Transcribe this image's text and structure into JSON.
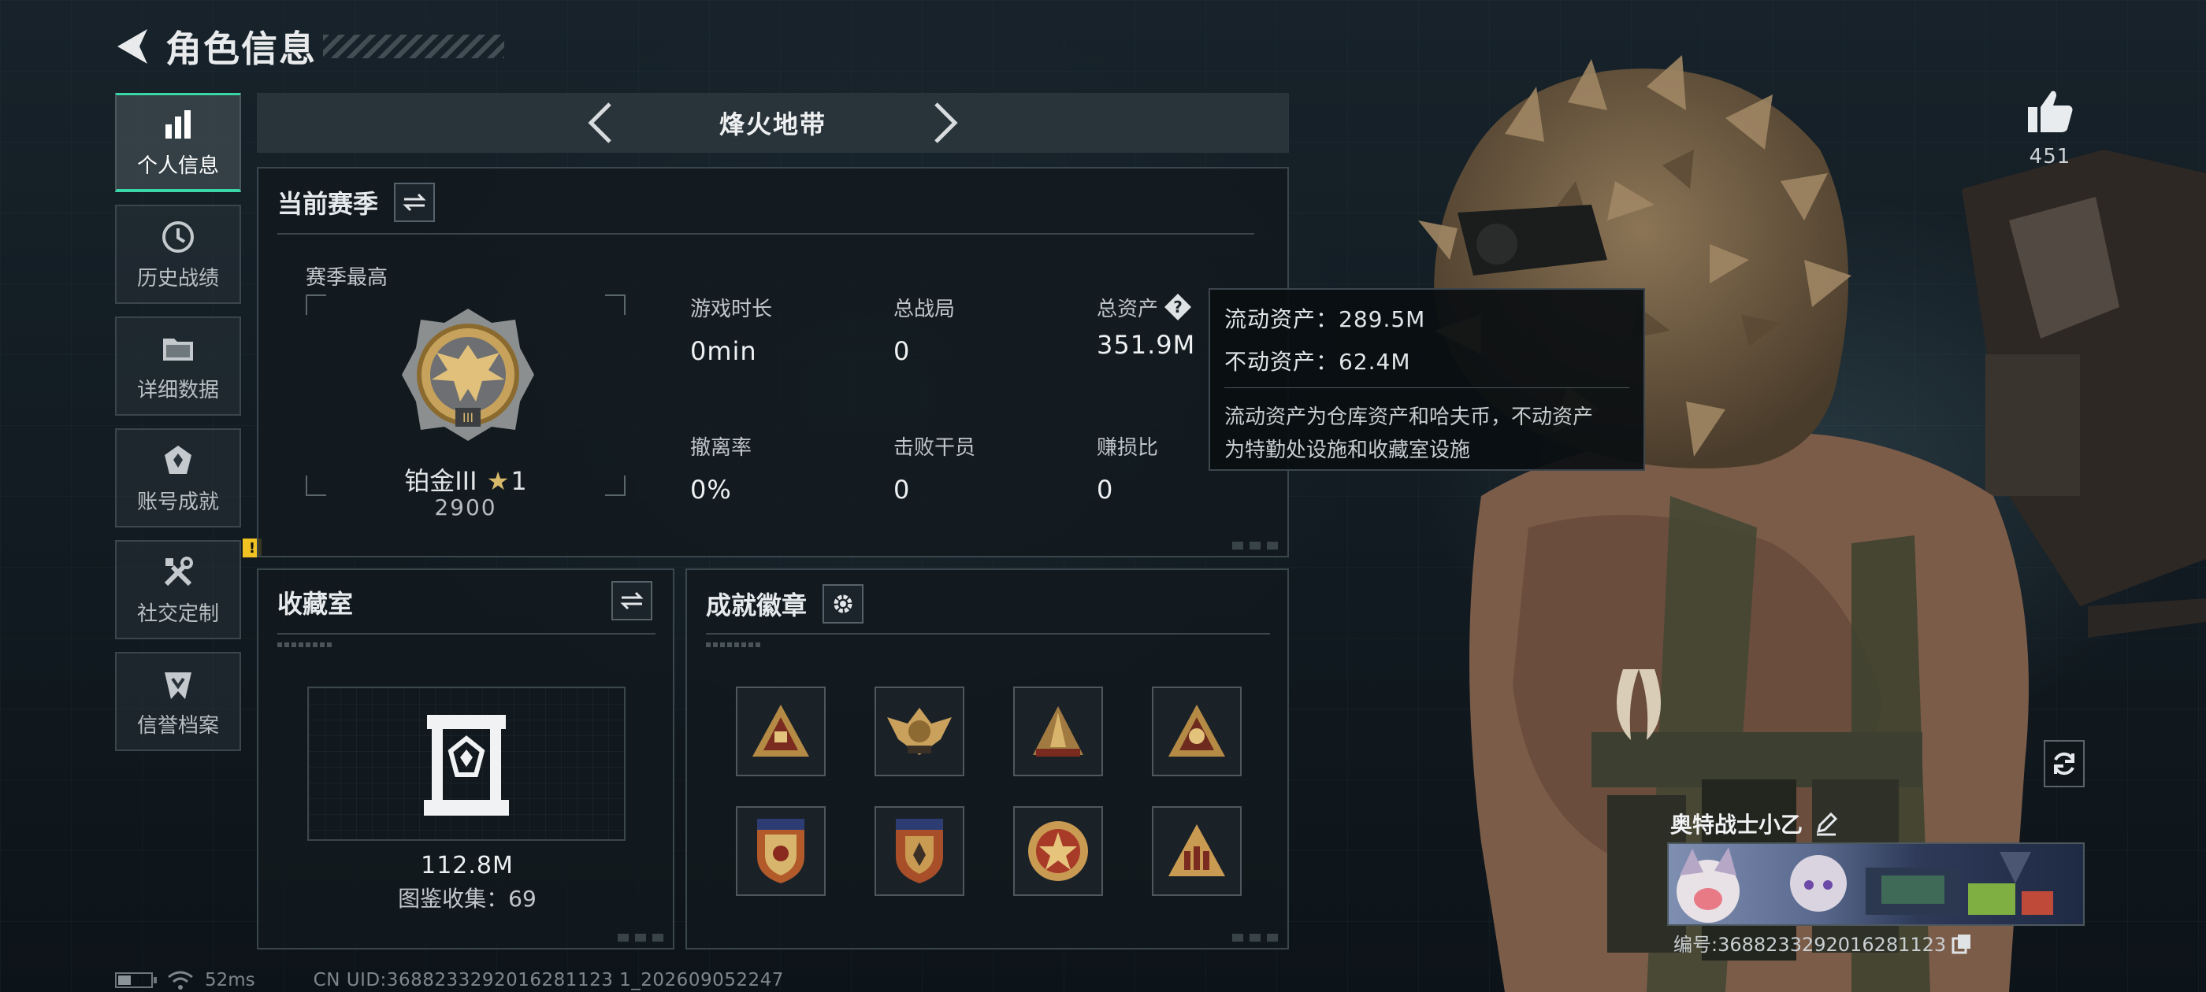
{
  "header": {
    "title": "角色信息"
  },
  "sidebar": {
    "items": [
      {
        "label": "个人信息",
        "icon": "bar-chart-icon",
        "active": true
      },
      {
        "label": "历史战绩",
        "icon": "history-icon",
        "active": false
      },
      {
        "label": "详细数据",
        "icon": "folder-icon",
        "active": false
      },
      {
        "label": "账号成就",
        "icon": "achievement-icon",
        "active": false
      },
      {
        "label": "社交定制",
        "icon": "tools-icon",
        "active": false,
        "badge": "!"
      },
      {
        "label": "信誉档案",
        "icon": "credit-icon",
        "active": false
      }
    ]
  },
  "mode_bar": {
    "title": "烽火地带"
  },
  "season": {
    "title": "当前赛季",
    "best_label": "赛季最高",
    "rank_name": "铂金III",
    "rank_stars": "1",
    "rank_score": "2900",
    "stats": [
      {
        "label": "游戏时长",
        "value": "0min"
      },
      {
        "label": "总战局",
        "value": "0"
      },
      {
        "label": "总资产",
        "value": "351.9M"
      },
      {
        "label": "撤离率",
        "value": "0%"
      },
      {
        "label": "击败干员",
        "value": "0"
      },
      {
        "label": "赚损比",
        "value": "0"
      }
    ]
  },
  "tooltip": {
    "liquid": "流动资产：289.5M",
    "fixed": "不动资产：62.4M",
    "desc_line1": "流动资产为仓库资产和哈夫币，不动资产",
    "desc_line2": "为特勤处设施和收藏室设施"
  },
  "collection": {
    "title": "收藏室",
    "value": "112.8M",
    "count_text": "图鉴收集：69"
  },
  "achievements": {
    "title": "成就徽章",
    "badges": [
      {
        "icon": "triangle-gold-badge-icon"
      },
      {
        "icon": "eagle-badge-icon"
      },
      {
        "icon": "peak-triangle-badge-icon"
      },
      {
        "icon": "skull-triangle-badge-icon"
      },
      {
        "icon": "shield-stars-badge-icon"
      },
      {
        "icon": "shield-blue-badge-icon"
      },
      {
        "icon": "round-star-badge-icon"
      },
      {
        "icon": "figures-triangle-badge-icon"
      }
    ]
  },
  "profile": {
    "likes": "451",
    "player_name": "奥特战士小乙",
    "player_id": "编号:3688233292016281123"
  },
  "status": {
    "ping": "52ms",
    "uid": "CN UID:3688233292016281123 1_202609052247"
  },
  "colors": {
    "accent": "#39d6a8",
    "alert": "#f0c323",
    "panel_border": "#3a464d"
  }
}
